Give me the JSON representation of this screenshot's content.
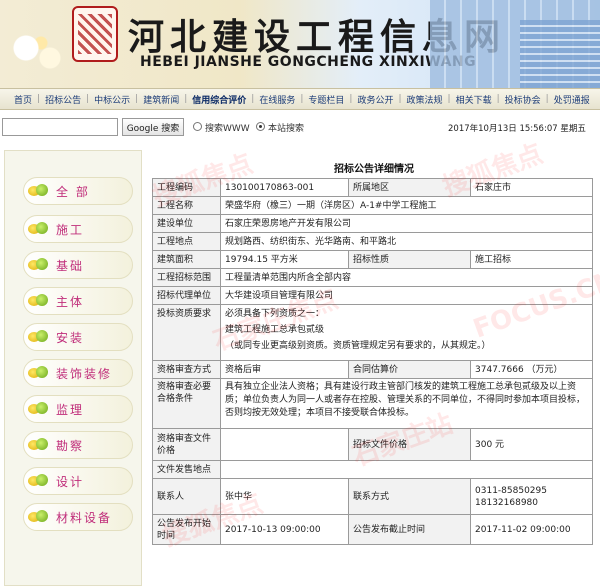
{
  "header": {
    "logo_cn": "河北建设工程信息网",
    "logo_en": "HEBEI JIANSHE GONGCHENG XINXIWANG"
  },
  "nav": {
    "items": [
      "首页",
      "招标公告",
      "中标公示",
      "建筑新闻",
      "信用综合评价",
      "在线服务",
      "专题栏目",
      "政务公开",
      "政策法规",
      "相关下载",
      "投标协会",
      "处罚通报"
    ],
    "active_index": 4
  },
  "search": {
    "input_value": "",
    "button_label": "Google 搜索",
    "radio_www": "搜索WWW",
    "radio_site": "本站搜索",
    "selected": "site"
  },
  "datetime": "2017年10月13日 15:56:07 星期五",
  "sidebar": {
    "items": [
      {
        "label": "全 部"
      },
      {
        "label": "施工"
      },
      {
        "label": "基础"
      },
      {
        "label": "主体"
      },
      {
        "label": "安装"
      },
      {
        "label": "装饰装修"
      },
      {
        "label": "监理"
      },
      {
        "label": "勘察"
      },
      {
        "label": "设计"
      },
      {
        "label": "材料设备"
      }
    ]
  },
  "doc": {
    "title": "招标公告详细情况",
    "project_no_label": "工程编码",
    "project_no": "130100170863-001",
    "region_label": "所属地区",
    "region": "石家庄市",
    "project_name_label": "工程名称",
    "project_name": "荣盛华府（橡三）一期（洋房区）A-1#中学工程施工",
    "builder_label": "建设单位",
    "builder": "石家庄荣恩房地产开发有限公司",
    "site_label": "工程地点",
    "site": "规划路西、纺织街东、光华路南、和平路北",
    "area_label": "建筑面积",
    "area": "19794.15 平方米",
    "tender_type_label": "招标性质",
    "tender_type": "施工招标",
    "scope_label": "工程招标范围",
    "scope": "工程量清单范围内所含全部内容",
    "agent_label": "招标代理单位",
    "agent": "大华建设项目管理有限公司",
    "qual_label": "投标资质要求",
    "qual_line1": "必须具备下列资质之一：",
    "qual_line2": "建筑工程施工总承包贰级",
    "qual_line3": "（或同专业更高级别资质。资质管理规定另有要求的，从其规定。）",
    "review_mode_label": "资格审查方式",
    "review_mode": "资格后审",
    "price_label": "合同估算价",
    "price": "3747.7666 （万元）",
    "review_cond_label": "资格审查必要合格条件",
    "review_cond": "具有独立企业法人资格；具有建设行政主管部门核发的建筑工程施工总承包贰级及以上资质；单位负责人为同一人或者存在控股、管理关系的不同单位，不得同时参加本项目投标，否则均按无效处理；本项目不接受联合体投标。",
    "doc_price_label": "资格审查文件价格",
    "tender_doc_price_label": "招标文件价格",
    "tender_doc_price": "300 元",
    "doc_place_label": "文件发售地点",
    "contact_label": "联系人",
    "contact": "张中华",
    "contact_method_label": "联系方式",
    "contact_phone1": "0311-85850295",
    "contact_phone2": "18132168980",
    "publish_start_label": "公告发布开始时间",
    "publish_start": "2017-10-13 09:00:00",
    "publish_end_label": "公告发布截止时间",
    "publish_end": "2017-11-02 09:00:00"
  },
  "watermarks": [
    "搜狐焦点",
    "搜狐焦点",
    "石家庄焦点",
    "FOCUS.CN",
    "石家庄站",
    "搜狐焦点"
  ]
}
